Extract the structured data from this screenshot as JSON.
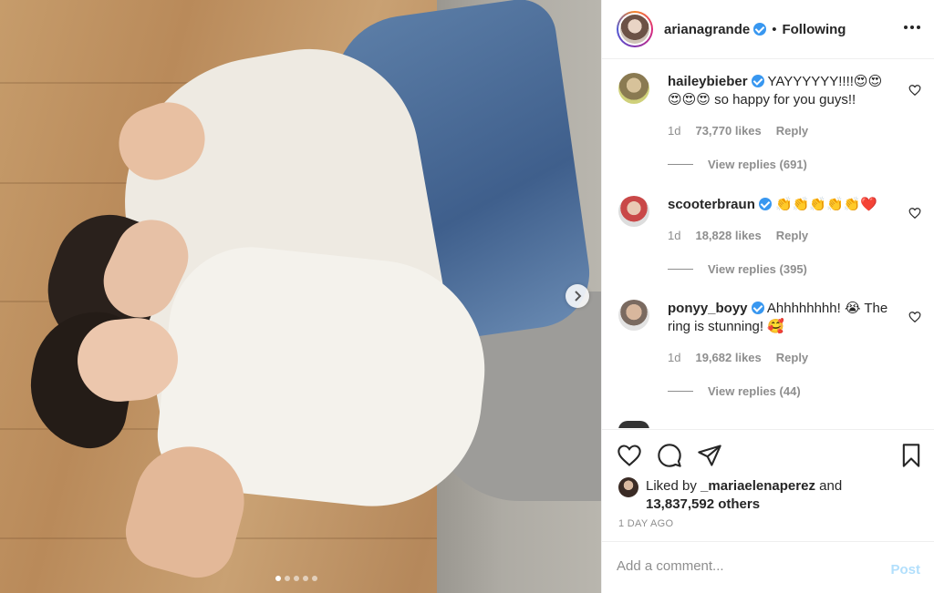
{
  "post": {
    "author": "arianagrande",
    "separator": "•",
    "follow_status": "Following",
    "carousel": {
      "total_images": 5,
      "active_index": 1
    }
  },
  "comments": [
    {
      "username": "haileybieber",
      "verified": true,
      "text_line1": "YAYYYYYY!!!!😍😍",
      "text_line2": "😍😍😍 so happy for you guys!!",
      "age": "1d",
      "likes": "73,770 likes",
      "reply": "Reply",
      "view_replies": "View replies (691)"
    },
    {
      "username": "scooterbraun",
      "verified": true,
      "text_line1": "👏👏👏👏👏❤️",
      "age": "1d",
      "likes": "18,828 likes",
      "reply": "Reply",
      "view_replies": "View replies (395)"
    },
    {
      "username": "ponyy_boyy",
      "verified": true,
      "text_line1": "Ahhhhhhhh! 😭 The",
      "text_line2": "ring is stunning! 🥰",
      "age": "1d",
      "likes": "19,682 likes",
      "reply": "Reply",
      "view_replies": "View replies (44)"
    }
  ],
  "likes_summary": {
    "prefix": "Liked by",
    "user": "_mariaelenaperez",
    "joiner": "and",
    "others": "13,837,592 others"
  },
  "time_ago": "1 DAY AGO",
  "add_comment": {
    "placeholder": "Add a comment...",
    "post_label": "Post"
  },
  "icons": {
    "like": "heart-icon",
    "comment": "comment-icon",
    "share": "paper-plane-icon",
    "save": "bookmark-icon",
    "next": "chevron-right-icon",
    "more": "more-options-icon"
  },
  "colors": {
    "verified": "#3897f0",
    "post_disabled": "#b2dffc",
    "secondary_text": "#8e8e8e",
    "primary_text": "#262626"
  }
}
